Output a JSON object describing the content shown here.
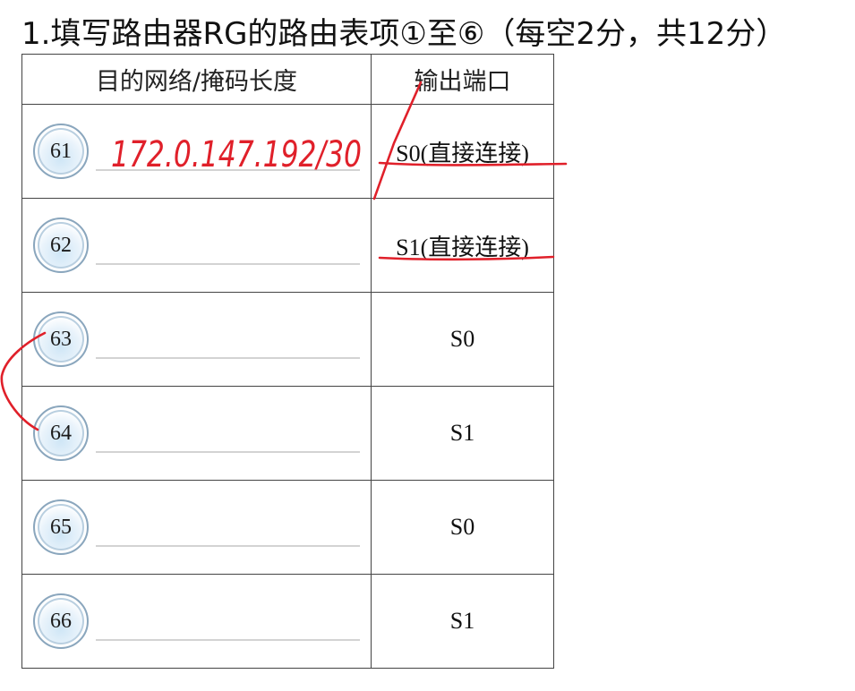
{
  "question": {
    "title": "1.填写路由器RG的路由表项①至⑥（每空2分，共12分）"
  },
  "table": {
    "headers": {
      "destination": "目的网络/掩码长度",
      "port": "输出端口"
    },
    "rows": [
      {
        "number": "61",
        "port": "S0(直接连接)"
      },
      {
        "number": "62",
        "port": "S1(直接连接)"
      },
      {
        "number": "63",
        "port": "S0"
      },
      {
        "number": "64",
        "port": "S1"
      },
      {
        "number": "65",
        "port": "S0"
      },
      {
        "number": "66",
        "port": "S1"
      }
    ]
  },
  "annotations": {
    "handwritten_answer": "172.0.147.192/30",
    "ink_color": "#e0202a"
  }
}
